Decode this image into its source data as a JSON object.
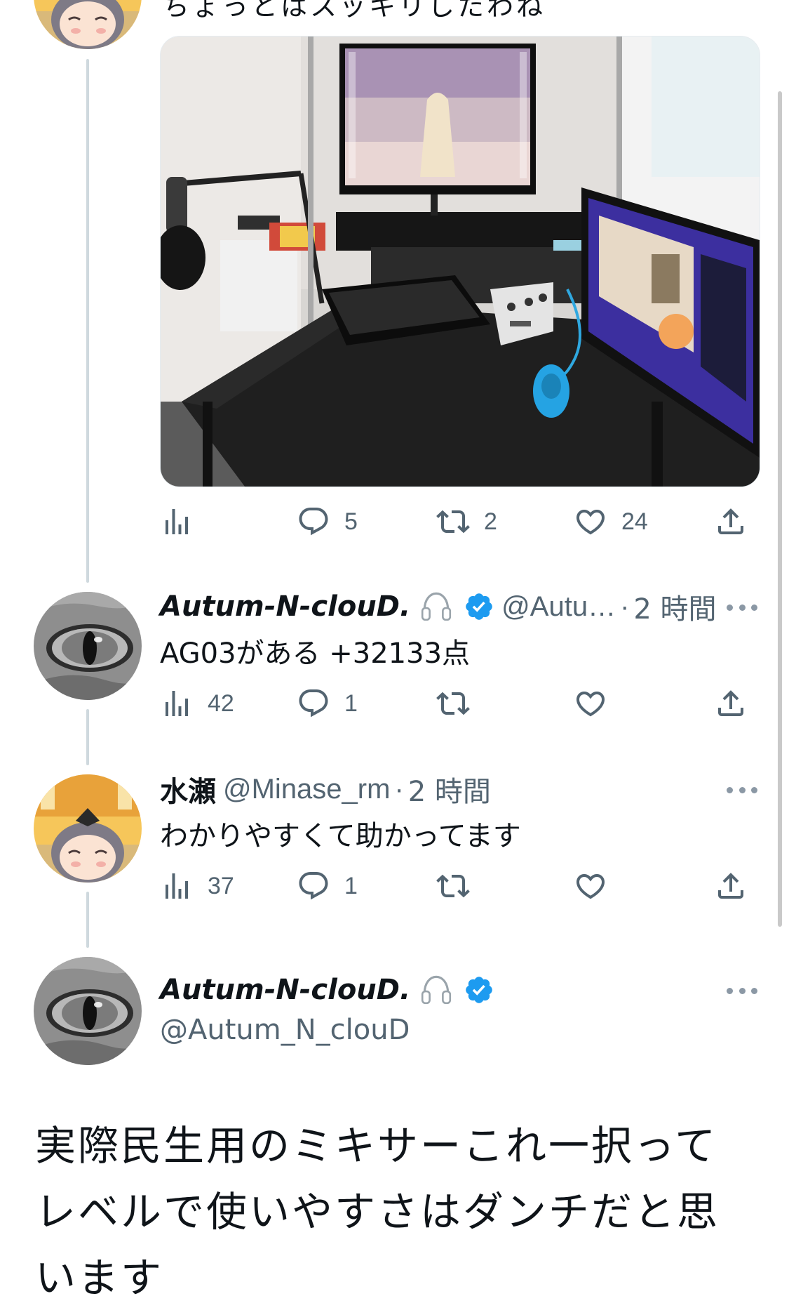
{
  "top_tweet": {
    "clipped_text": "ちょっとはスッキリしたわね",
    "actions": {
      "views": "",
      "replies": "5",
      "retweets": "2",
      "likes": "24"
    }
  },
  "reply1": {
    "name": "Autum-N-clouD.",
    "handle": "@Autu…",
    "separator": "·",
    "time": "2 時間",
    "text": "AG03がある +32133点",
    "actions": {
      "views": "42",
      "replies": "1",
      "retweets": "",
      "likes": ""
    }
  },
  "reply2": {
    "name": "水瀬",
    "handle": "@Minase_rm",
    "separator": "·",
    "time": "2 時間",
    "text": "わかりやすくて助かってます",
    "actions": {
      "views": "37",
      "replies": "1",
      "retweets": "",
      "likes": ""
    }
  },
  "main_tweet": {
    "name": "Autum-N-clouD.",
    "handle": "@Autum_N_clouD",
    "text": "実際民生用のミキサーこれ一択ってレベルで使いやすさはダンチだと思います"
  },
  "colors": {
    "verified": "#1d9bf0",
    "secondary_text": "#536471",
    "thread_line": "#cfd9de"
  },
  "icons": [
    "views-icon",
    "reply-icon",
    "retweet-icon",
    "like-icon",
    "share-icon",
    "more-icon",
    "verified-badge-icon",
    "headphones-icon"
  ]
}
